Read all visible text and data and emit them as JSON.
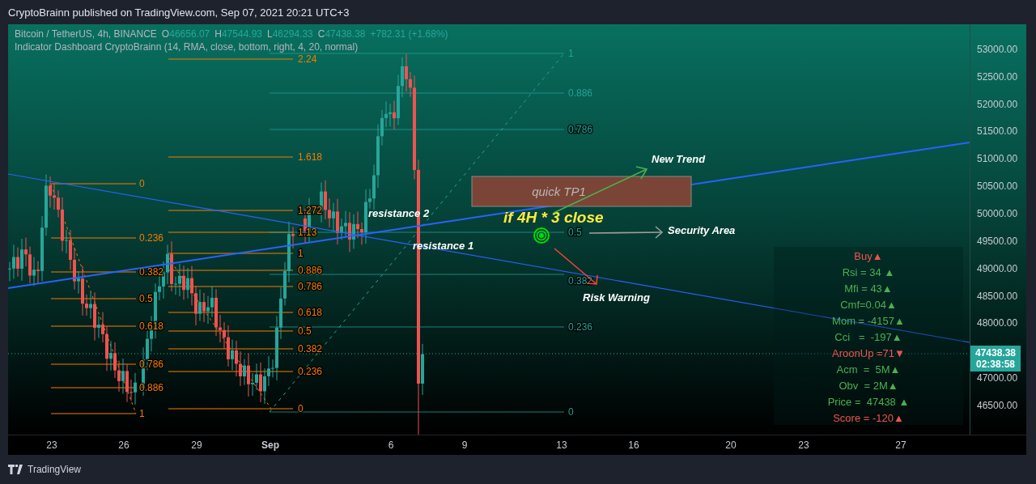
{
  "header": {
    "publisher_line": "CryptoBrainn published on TradingView.com, Sep 07, 2021 20:21 UTC+3"
  },
  "legend": {
    "symbol": "Bitcoin / TetherUS, 4h, BINANCE",
    "ohlc": [
      {
        "label": "O",
        "value": "46656.07"
      },
      {
        "label": "H",
        "value": "47544.93"
      },
      {
        "label": "L",
        "value": "46294.33"
      },
      {
        "label": "C",
        "value": "47438.38"
      }
    ],
    "change": "+782.31 (+1.68%)",
    "indicator": "Indicator Dashboard CryptoBrainn (14, RMA, close, bottom, right, 4, 20, normal)"
  },
  "fib_sets": [
    {
      "color": "#f57c00",
      "levels": [
        "0",
        "0.236",
        "0.382",
        "0.5",
        "0.618",
        "0.786",
        "0.886",
        "1"
      ]
    },
    {
      "color": "#f57c00",
      "levels": [
        "2.24",
        "1.618",
        "1.272",
        "1.13",
        "1",
        "0.886",
        "0.786",
        "0.618",
        "0.5",
        "0.382",
        "0.236",
        "0"
      ]
    },
    {
      "color": "#22a39a",
      "levels": [
        "1",
        "0.886",
        "0.786",
        "0.5",
        "0.382",
        "0.236",
        "0"
      ]
    }
  ],
  "annotations": [
    {
      "kind": "label",
      "text": "resistance 2"
    },
    {
      "kind": "label",
      "text": "resistance 1"
    },
    {
      "kind": "box",
      "text": "quick TP1"
    },
    {
      "kind": "headline",
      "text": "if 4H * 3 close"
    },
    {
      "kind": "label",
      "text": "New Trend"
    },
    {
      "kind": "label",
      "text": "Security Area"
    },
    {
      "kind": "label",
      "text": "Risk Warning"
    }
  ],
  "dashboard": {
    "rows": [
      {
        "text": "Buy▲",
        "color": "#f05350"
      },
      {
        "text": "Rsi = 34 ▲",
        "color": "#4caf50"
      },
      {
        "text": "Mfi = 43▲",
        "color": "#4caf50"
      },
      {
        "text": "Cmf=0.04▲",
        "color": "#4caf50"
      },
      {
        "text": "Mom = -4157▲",
        "color": "#4caf50"
      },
      {
        "text": "Cci   =  -197▲",
        "color": "#4caf50"
      },
      {
        "text": "AroonUp =71▼",
        "color": "#f05350"
      },
      {
        "text": "Acm  =  5M▲",
        "color": "#4caf50"
      },
      {
        "text": "Obv  = 2M▲",
        "color": "#4caf50"
      },
      {
        "text": "Price =  47438 ▲",
        "color": "#4caf50"
      },
      {
        "text": "Score = -120▲",
        "color": "#f05350"
      }
    ]
  },
  "price_axis": {
    "labels": [
      "53000.00",
      "52500.00",
      "52000.00",
      "51500.00",
      "51000.00",
      "50500.00",
      "50000.00",
      "49500.00",
      "49000.00",
      "48500.00",
      "48000.00",
      "47000.00",
      "46500.00"
    ],
    "current_price": "47438.38",
    "countdown": "02:38:58"
  },
  "time_axis": {
    "labels": [
      "23",
      "26",
      "29",
      "Sep",
      "6",
      "9",
      "13",
      "16",
      "20",
      "23",
      "27"
    ]
  },
  "footer": {
    "brand": "TradingView"
  }
}
